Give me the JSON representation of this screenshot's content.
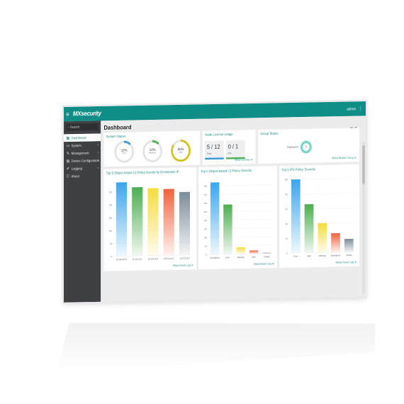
{
  "app": {
    "logo": "MXsecurity",
    "user": "admin",
    "menu_glyph": "≡",
    "dots_glyph": "⋮"
  },
  "sidebar": {
    "search_placeholder": "Search",
    "items": [
      {
        "label": "Dashboard",
        "icon": "grid-icon",
        "glyph": "▦",
        "active": true,
        "chevron": ""
      },
      {
        "label": "System",
        "icon": "monitor-icon",
        "glyph": "▭",
        "active": false,
        "chevron": "›"
      },
      {
        "label": "Management",
        "icon": "wrench-icon",
        "glyph": "✎",
        "active": false,
        "chevron": "›"
      },
      {
        "label": "Device Configuration",
        "icon": "device-icon",
        "glyph": "▤",
        "active": false,
        "chevron": "›"
      },
      {
        "label": "Logging",
        "icon": "log-icon",
        "glyph": "✐",
        "active": false,
        "chevron": "›"
      },
      {
        "label": "About",
        "icon": "info-icon",
        "glyph": "ⓘ",
        "active": false,
        "chevron": ""
      }
    ]
  },
  "page": {
    "title": "Dashboard",
    "icons": "▤ ⚙"
  },
  "system_status": {
    "title": "System Status",
    "rings": [
      {
        "value": "12%",
        "label": "CPU",
        "pct": 12,
        "color": "#3a9bd6"
      },
      {
        "value": "12%",
        "label": "Memory",
        "pct": 12,
        "color": "#4caf50"
      },
      {
        "value": "85%",
        "label": "Disk",
        "pct": 85,
        "color": "#d4c21c"
      }
    ]
  },
  "node_license": {
    "title": "Node License Usage",
    "boxes": [
      {
        "value": "5 / 12",
        "label": "Total"
      },
      {
        "value": "0 / 1",
        "label": "IPS"
      }
    ],
    "more": "Show License ➔"
  },
  "group_status": {
    "title": "Group Status",
    "legend": "Ungrouped",
    "center": "0",
    "more": "Show Device Group ➔"
  },
  "panels": [
    {
      "title": "Top 5 Object-based L3 Policy Events by Destination IP",
      "more": "Show Event Log ➔",
      "chart_data": {
        "type": "bar",
        "categories": [
          "10.123.16.37",
          "10.123.16.1",
          "10.123.16.2",
          "10.123.16.4",
          "10.123.16.3"
        ],
        "values": [
          287,
          267,
          262,
          258,
          245
        ],
        "yticks": [
          "0",
          "50",
          "100",
          "150",
          "200",
          "250"
        ],
        "ylim": [
          0,
          300
        ],
        "colors": [
          "#3aa6ee",
          "#4cae50",
          "#f5dc3c",
          "#f4613c",
          "#7b8c99"
        ]
      }
    },
    {
      "title": "Top 5 Object-based L3 Policy Severity",
      "more": "Show Event Log ➔",
      "chart_data": {
        "type": "bar",
        "categories": [
          "Emergency",
          "Error",
          "Warning",
          "Alert",
          "Critical"
        ],
        "values": [
          420,
          290,
          40,
          20,
          5
        ],
        "yticks": [
          "0",
          "50",
          "100",
          "150",
          "200",
          "250",
          "300",
          "350",
          "400"
        ],
        "ylim": [
          0,
          450
        ],
        "colors": [
          "#3aa6ee",
          "#4cae50",
          "#f5dc3c",
          "#f4613c",
          "#7b8c99"
        ]
      }
    },
    {
      "title": "Top 5 IPS Policy Severity",
      "more": "Show Event Log ➔",
      "chart_data": {
        "type": "bar",
        "categories": [
          "Error",
          "Alert",
          "Warning",
          "Emergency",
          "Critical"
        ],
        "values": [
          100,
          66,
          40,
          26,
          18
        ],
        "yticks": [
          "0",
          "20",
          "40",
          "60",
          "80",
          "100"
        ],
        "ylim": [
          0,
          105
        ],
        "colors": [
          "#3aa6ee",
          "#4cae50",
          "#f5dc3c",
          "#f4613c",
          "#7b8c99"
        ]
      }
    }
  ]
}
